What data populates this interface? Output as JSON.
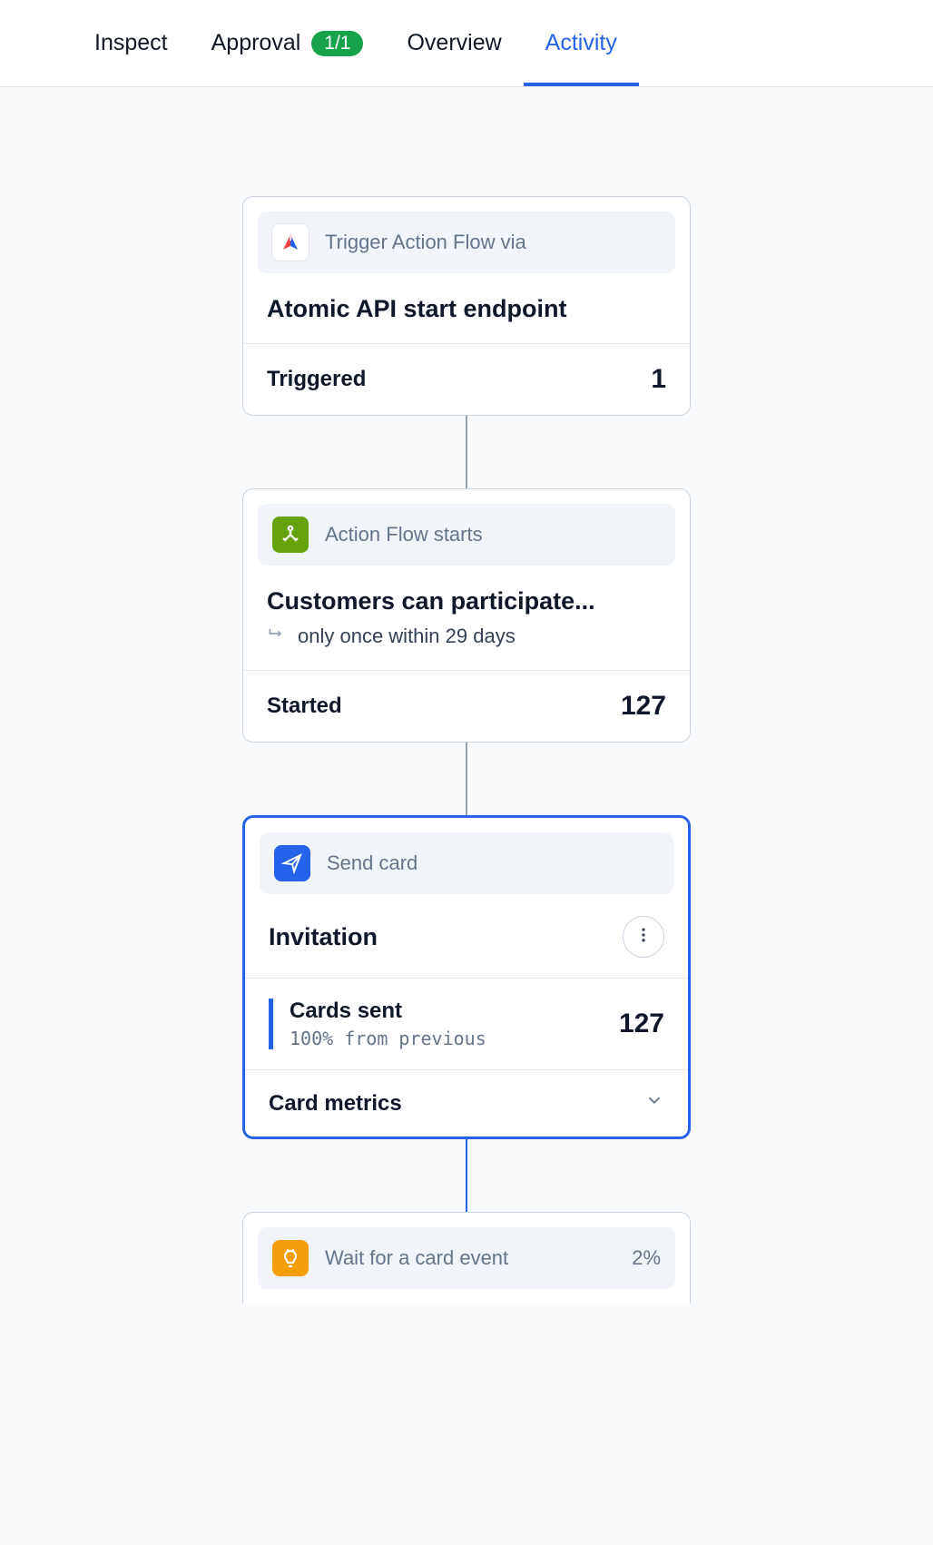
{
  "tabs": {
    "inspect": "Inspect",
    "approval": "Approval",
    "approval_badge": "1/1",
    "overview": "Overview",
    "activity": "Activity"
  },
  "node_trigger": {
    "stage_label": "Trigger Action Flow via",
    "title": "Atomic API start endpoint",
    "stat_label": "Triggered",
    "stat_value": "1"
  },
  "node_start": {
    "stage_label": "Action Flow starts",
    "title": "Customers can participate...",
    "sub": "only once within 29 days",
    "stat_label": "Started",
    "stat_value": "127"
  },
  "node_send": {
    "stage_label": "Send card",
    "title": "Invitation",
    "stat_label": "Cards sent",
    "stat_value": "127",
    "stat_sub": "100% from previous",
    "metrics_label": "Card metrics"
  },
  "node_wait": {
    "stage_label": "Wait for a card event",
    "percent": "2%"
  }
}
